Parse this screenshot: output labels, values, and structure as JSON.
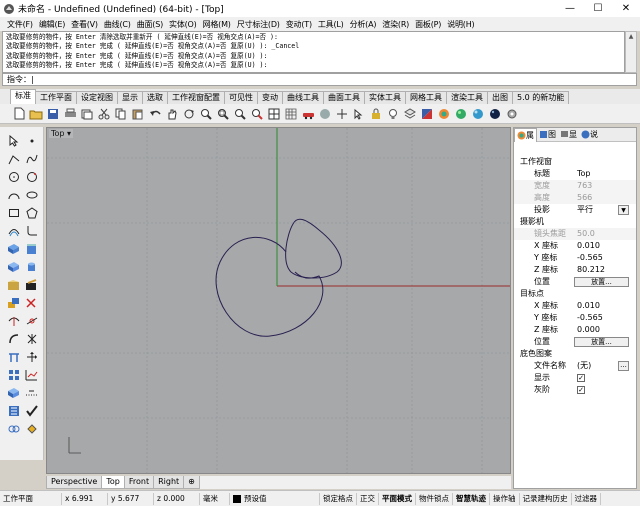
{
  "window": {
    "title": "未命名 - Undefined (Undefined) (64-bit) - [Top]",
    "min": "—",
    "max": "☐",
    "close": "✕"
  },
  "menu": [
    "文件(F)",
    "编辑(E)",
    "查看(V)",
    "曲线(C)",
    "曲面(S)",
    "实体(O)",
    "网格(M)",
    "尺寸标注(D)",
    "变动(T)",
    "工具(L)",
    "分析(A)",
    "渲染(R)",
    "面板(P)",
    "说明(H)"
  ],
  "command_history": [
    "选取要修剪的物件，按 Enter 清除选取并重新开 ( 延伸直线(E)=否  视角交点(A)=否 ):",
    "选取要修剪的物件，按 Enter 完成 ( 延伸直线(E)=否  视角交点(A)=否  复原(U) ): _Cancel",
    "选取要修剪的物件，按 Enter 完成 ( 延伸直线(E)=否  视角交点(A)=否  复原(U) ):",
    "选取要修剪的物件，按 Enter 完成 ( 延伸直线(E)=否  视角交点(A)=否  复原(U) ):",
    "指令: _Cancel"
  ],
  "command_prompt": "指令：|",
  "toolbar_tabs": [
    "标准",
    "工作平面",
    "设定视图",
    "显示",
    "选取",
    "工作视窗配置",
    "可见性",
    "变动",
    "曲线工具",
    "曲面工具",
    "实体工具",
    "网格工具",
    "渲染工具",
    "出图",
    "5.0 的新功能"
  ],
  "viewport": {
    "label": "Top ▾",
    "tabs": [
      "Perspective",
      "Top",
      "Front",
      "Right",
      "⊕"
    ],
    "active_tab": "Top",
    "colors": {
      "background": "#a6a8aa",
      "grid": "#8e9395",
      "x_axis": "#9a2a2a",
      "y_axis": "#2f8a2f",
      "curve": "#2a2050"
    }
  },
  "panel": {
    "tabs": [
      "属",
      "图",
      "显",
      "说"
    ],
    "section_viewport": "工作视窗",
    "title_label": "标题",
    "title_value": "Top",
    "width_label": "宽度",
    "width_value": "763",
    "height_label": "高度",
    "height_value": "566",
    "projection_label": "投影",
    "projection_value": "平行",
    "section_camera": "摄影机",
    "lens_label": "镜头焦距",
    "lens_value": "50.0",
    "cx_label": "X 座标",
    "cx_value": "0.010",
    "cy_label": "Y 座标",
    "cy_value": "-0.565",
    "cz_label": "Z 座标",
    "cz_value": "80.212",
    "cpos_label": "位置",
    "cpos_btn": "放置...",
    "section_target": "目标点",
    "tx_label": "X 座标",
    "tx_value": "0.010",
    "ty_label": "Y 座标",
    "ty_value": "-0.565",
    "tz_label": "Z 座标",
    "tz_value": "0.000",
    "tpos_label": "位置",
    "tpos_btn": "放置...",
    "section_bg": "底色图案",
    "file_label": "文件名称",
    "file_value": "(无)",
    "show_label": "显示",
    "gray_label": "灰阶",
    "check_mark": "✓"
  },
  "status": {
    "cplane": "工作平面",
    "x": "x 6.991",
    "y": "y 5.677",
    "z": "z 0.000",
    "unit": "毫米",
    "layer": "预设值",
    "toggles": [
      "锁定格点",
      "正交",
      "平面模式",
      "物件锁点",
      "智慧轨迹",
      "操作轴",
      "记录建构历史",
      "过滤器"
    ]
  }
}
